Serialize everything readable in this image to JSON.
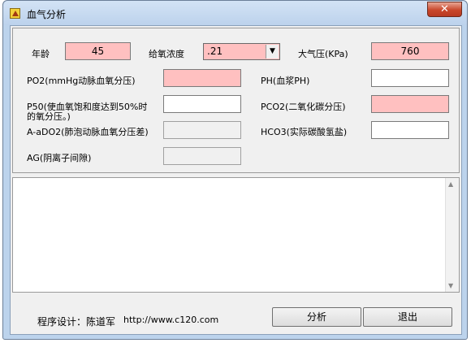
{
  "window": {
    "title": "血气分析",
    "close_glyph": "✕"
  },
  "form": {
    "age_label": "年龄",
    "age_value": "45",
    "fio2_label": "给氧浓度",
    "fio2_value": ".21",
    "pressure_label": "大气压(KPa)",
    "pressure_value": "760",
    "po2_label": "PO2(mmHg动脉血氧分压)",
    "ph_label": "PH(血浆PH)",
    "p50_label_line1": "P50(使血氧饱和度达到50%时",
    "p50_label_line2": "的氧分压。)",
    "pco2_label": "PCO2(二氧化碳分压)",
    "aado2_label": "A-aDO2(肺泡动脉血氧分压差)",
    "hco3_label": "HCO3(实际碳酸氢盐)",
    "ag_label": "AG(阴离子间隙)"
  },
  "footer": {
    "designer": "程序设计：陈道军",
    "url": "http://www.c120.com",
    "analyze_label": "分析",
    "exit_label": "退出"
  },
  "colors": {
    "required_field": "#ffc0c0",
    "window_frame": "#bcd3ec",
    "close_button": "#c9472b"
  }
}
